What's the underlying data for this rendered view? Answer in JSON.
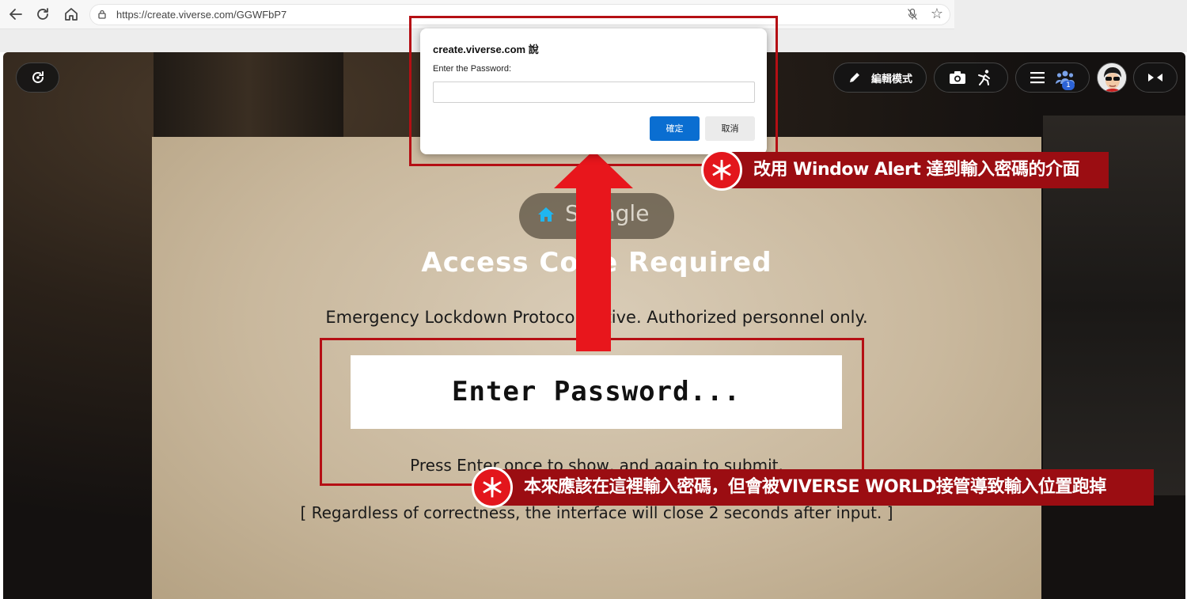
{
  "browser": {
    "url": "https://create.viverse.com/GGWFbP7"
  },
  "hud": {
    "edit_mode_label": "編輯模式",
    "participants_count": "1"
  },
  "space": {
    "name": "Stangle"
  },
  "panel": {
    "title": "Access Code Required",
    "subtitle": "Emergency Lockdown Protocol Active. Authorized personnel only.",
    "password_box": "Enter Password...",
    "press_hint": "Press Enter once to show, and again to submit.",
    "regardless_note": "[ Regardless of correctness, the interface will close 2 seconds after input. ]"
  },
  "dialog": {
    "origin": "create.viverse.com 說",
    "prompt": "Enter the Password:",
    "input_value": "",
    "ok_label": "確定",
    "cancel_label": "取消"
  },
  "callouts": {
    "top": "改用 Window Alert 達到輸入密碼的介面",
    "bottom": "本來應該在這裡輸入密碼，但會被VIVERSE WORLD接管導致輸入位置跑掉",
    "asterisk": "＊"
  },
  "colors": {
    "highlight_red": "#b50f14",
    "callout_bg": "#9b0d12",
    "asterisk_bg": "#e3161c",
    "ok_blue": "#0a6ed1",
    "arrow_red": "#e8161c"
  },
  "icons": {
    "back": "back-arrow-icon",
    "reload": "reload-icon",
    "home": "home-icon",
    "site_info": "site-info-icon",
    "mic_off": "mic-off-icon",
    "favorite": "star-icon",
    "refresh_world": "refresh-icon",
    "pencil": "pencil-icon",
    "camera": "camera-icon",
    "pose": "pose-icon",
    "menu": "menu-icon",
    "people": "people-icon",
    "collapse": "collapse-icon"
  }
}
